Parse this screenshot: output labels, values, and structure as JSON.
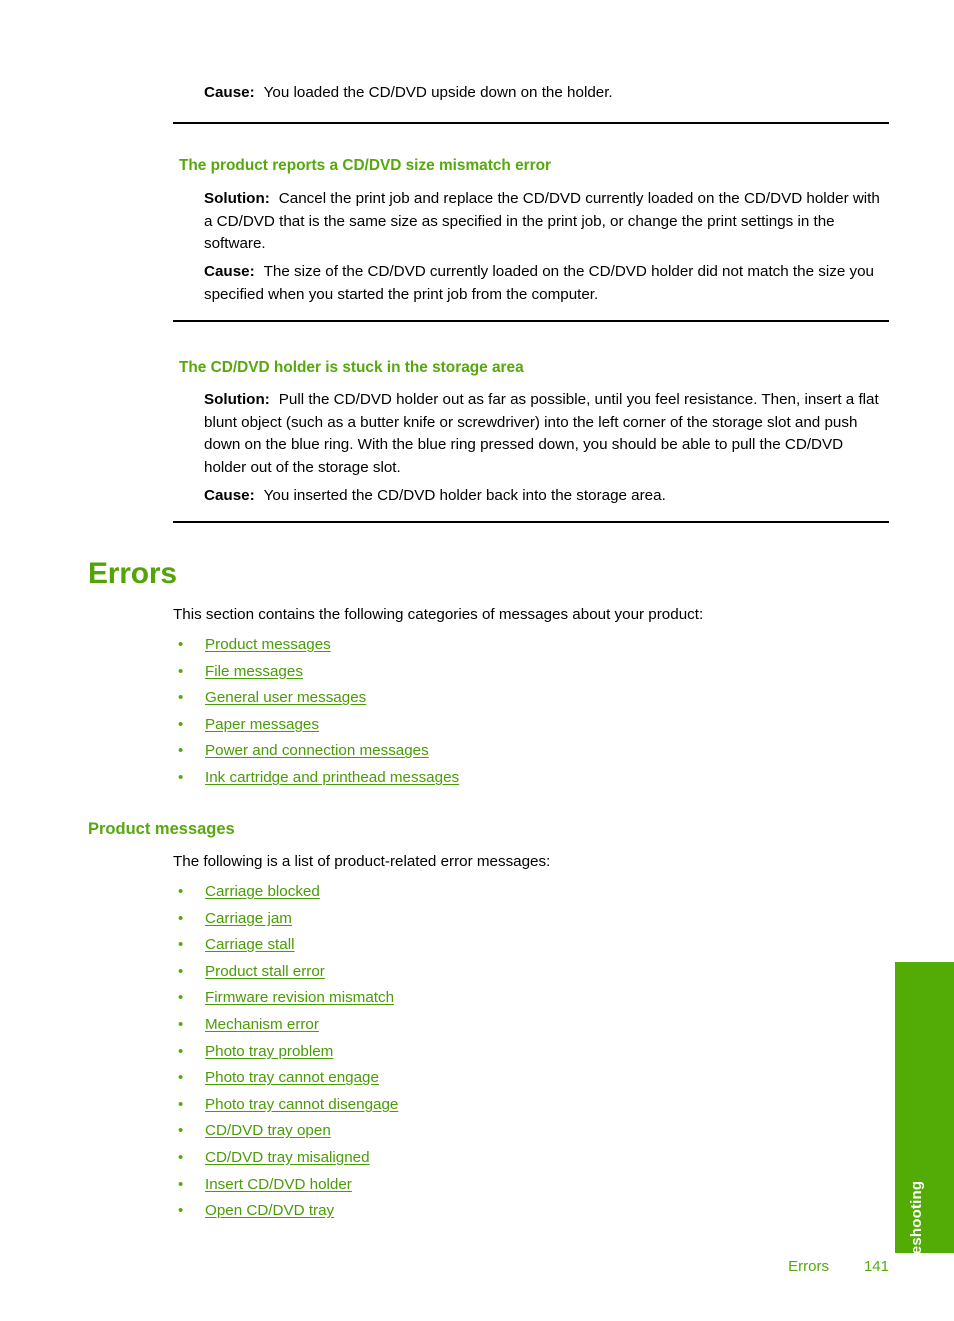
{
  "page": {
    "side_tab_label": "Troubleshooting",
    "footer_section": "Errors",
    "footer_page_number": "141",
    "accent_green": "#56a90c",
    "link_green": "#4a9c06",
    "tab_green": "#52ac05"
  },
  "top_cause": {
    "label": "Cause:",
    "text": "You loaded the CD/DVD upside down on the holder."
  },
  "section_size_mismatch": {
    "heading": "The product reports a CD/DVD size mismatch error",
    "solution_label": "Solution:",
    "solution_text": "Cancel the print job and replace the CD/DVD currently loaded on the CD/DVD holder with a CD/DVD that is the same size as specified in the print job, or change the print settings in the software.",
    "cause_label": "Cause:",
    "cause_text": "The size of the CD/DVD currently loaded on the CD/DVD holder did not match the size you specified when you started the print job from the computer."
  },
  "section_holder_stuck": {
    "heading": "The CD/DVD holder is stuck in the storage area",
    "solution_label": "Solution:",
    "solution_text": "Pull the CD/DVD holder out as far as possible, until you feel resistance. Then, insert a flat blunt object (such as a butter knife or screwdriver) into the left corner of the storage slot and push down on the blue ring. With the blue ring pressed down, you should be able to pull the CD/DVD holder out of the storage slot.",
    "cause_label": "Cause:",
    "cause_text": "You inserted the CD/DVD holder back into the storage area."
  },
  "errors_section": {
    "title": "Errors",
    "intro": "This section contains the following categories of messages about your product:",
    "bullet": "•",
    "links": [
      "Product messages",
      "File messages",
      "General user messages",
      "Paper messages",
      "Power and connection messages",
      "Ink cartridge and printhead messages"
    ]
  },
  "product_messages_section": {
    "title": "Product messages",
    "intro": "The following is a list of product-related error messages:",
    "bullet": "•",
    "links": [
      "Carriage blocked",
      "Carriage jam",
      "Carriage stall",
      "Product stall error",
      "Firmware revision mismatch",
      "Mechanism error",
      "Photo tray problem",
      "Photo tray cannot engage",
      "Photo tray cannot disengage",
      "CD/DVD tray open",
      "CD/DVD tray misaligned",
      "Insert CD/DVD holder",
      "Open CD/DVD tray"
    ]
  }
}
